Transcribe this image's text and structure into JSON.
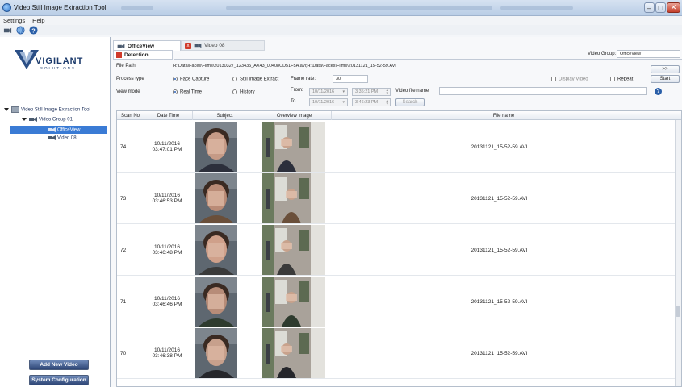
{
  "window": {
    "title": "Video Still Image Extraction Tool"
  },
  "menu": [
    "Settings",
    "Help"
  ],
  "toolbar": {
    "icons": [
      "camera-icon",
      "globe-icon",
      "help-icon"
    ]
  },
  "sidebar": {
    "logo": {
      "brand": "VIGILANT",
      "sub": "SOLUTIONS"
    },
    "tree": [
      {
        "label": "Video Still Image Extraction Tool"
      },
      {
        "label": "Video Group 01"
      },
      {
        "label": "OfficeView"
      },
      {
        "label": "Video 08"
      }
    ],
    "buttons": {
      "add_video": "Add New Video",
      "system_config": "System Configuration"
    }
  },
  "tabs": [
    {
      "label": "OfficeView"
    },
    {
      "label": "Video 08"
    }
  ],
  "subtab": {
    "label": "Detection"
  },
  "form": {
    "video_group_label": "Video Group:",
    "video_group_value": "OfficeView",
    "file_path_label": "File Path",
    "file_path_value": "H:\\Data\\Faces\\Films\\20130327_123435_AX43_00408CD51F5A.avi;H:\\Data\\Faces\\Films\\20131121_15-52-59.AVI",
    "process_type_label": "Process type",
    "face_capture": "Face Capture",
    "still_image": "Still Image Extract",
    "frame_rate_label": "Frame rate:",
    "frame_rate_value": "30",
    "display_video": "Display Video",
    "repeat": "Repeat",
    "next_btn": ">>",
    "start_btn": "Start",
    "view_mode_label": "View mode",
    "real_time": "Real Time",
    "history": "History",
    "from_label": "From:",
    "from_date": "10/11/2016",
    "from_time": "3:35:21 PM",
    "to_label": "To",
    "to_date": "10/11/2016",
    "to_time": "3:46:23 PM",
    "video_file_name_label": "Video file name",
    "search_btn": "Search"
  },
  "grid": {
    "headers": [
      "Scan No",
      "Date Time",
      "Subject",
      "Overview Image",
      "File name"
    ],
    "rows": [
      {
        "scan": "74",
        "date": "10/11/2016",
        "time": "03:47:01 PM",
        "file": "20131121_15-52-59.AVI"
      },
      {
        "scan": "73",
        "date": "10/11/2016",
        "time": "03:46:53 PM",
        "file": "20131121_15-52-59.AVI"
      },
      {
        "scan": "72",
        "date": "10/11/2016",
        "time": "03:46:48 PM",
        "file": "20131121_15-52-59.AVI"
      },
      {
        "scan": "71",
        "date": "10/11/2016",
        "time": "03:46:46 PM",
        "file": "20131121_15-52-59.AVI"
      },
      {
        "scan": "70",
        "date": "10/11/2016",
        "time": "03:46:38 PM",
        "file": "20131121_15-52-59.AVI"
      }
    ]
  },
  "colors": {
    "accent": "#3a7bd5",
    "nav": "#2e4676",
    "close": "#d03a2a"
  }
}
